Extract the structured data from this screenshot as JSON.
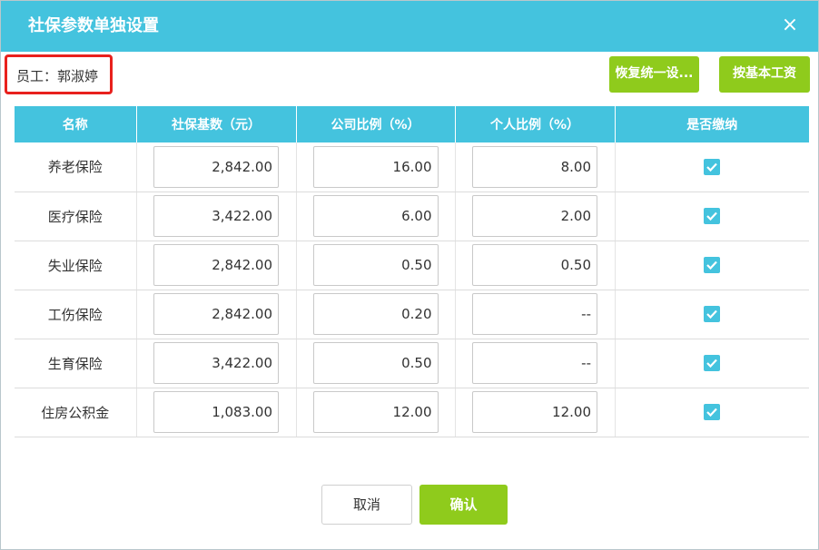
{
  "dialog": {
    "title": "社保参数单独设置",
    "close_glyph": "×"
  },
  "employee": {
    "label": "员工：郭淑婷"
  },
  "toolbar": {
    "restore_label": "恢复统一设...",
    "base_salary_label": "按基本工资"
  },
  "table": {
    "headers": [
      "名称",
      "社保基数（元）",
      "公司比例（%）",
      "个人比例（%）",
      "是否缴纳"
    ],
    "rows": [
      {
        "name": "养老保险",
        "base": "2,842.00",
        "company": "16.00",
        "personal": "8.00",
        "paid": true
      },
      {
        "name": "医疗保险",
        "base": "3,422.00",
        "company": "6.00",
        "personal": "2.00",
        "paid": true
      },
      {
        "name": "失业保险",
        "base": "2,842.00",
        "company": "0.50",
        "personal": "0.50",
        "paid": true
      },
      {
        "name": "工伤保险",
        "base": "2,842.00",
        "company": "0.20",
        "personal": "--",
        "paid": true
      },
      {
        "name": "生育保险",
        "base": "3,422.00",
        "company": "0.50",
        "personal": "--",
        "paid": true
      },
      {
        "name": "住房公积金",
        "base": "1,083.00",
        "company": "12.00",
        "personal": "12.00",
        "paid": true
      }
    ]
  },
  "footer": {
    "cancel_label": "取消",
    "confirm_label": "确认"
  },
  "colors": {
    "header_bg": "#44c3de",
    "green_button": "#8fcb1c",
    "highlight_border": "#e8211d"
  }
}
